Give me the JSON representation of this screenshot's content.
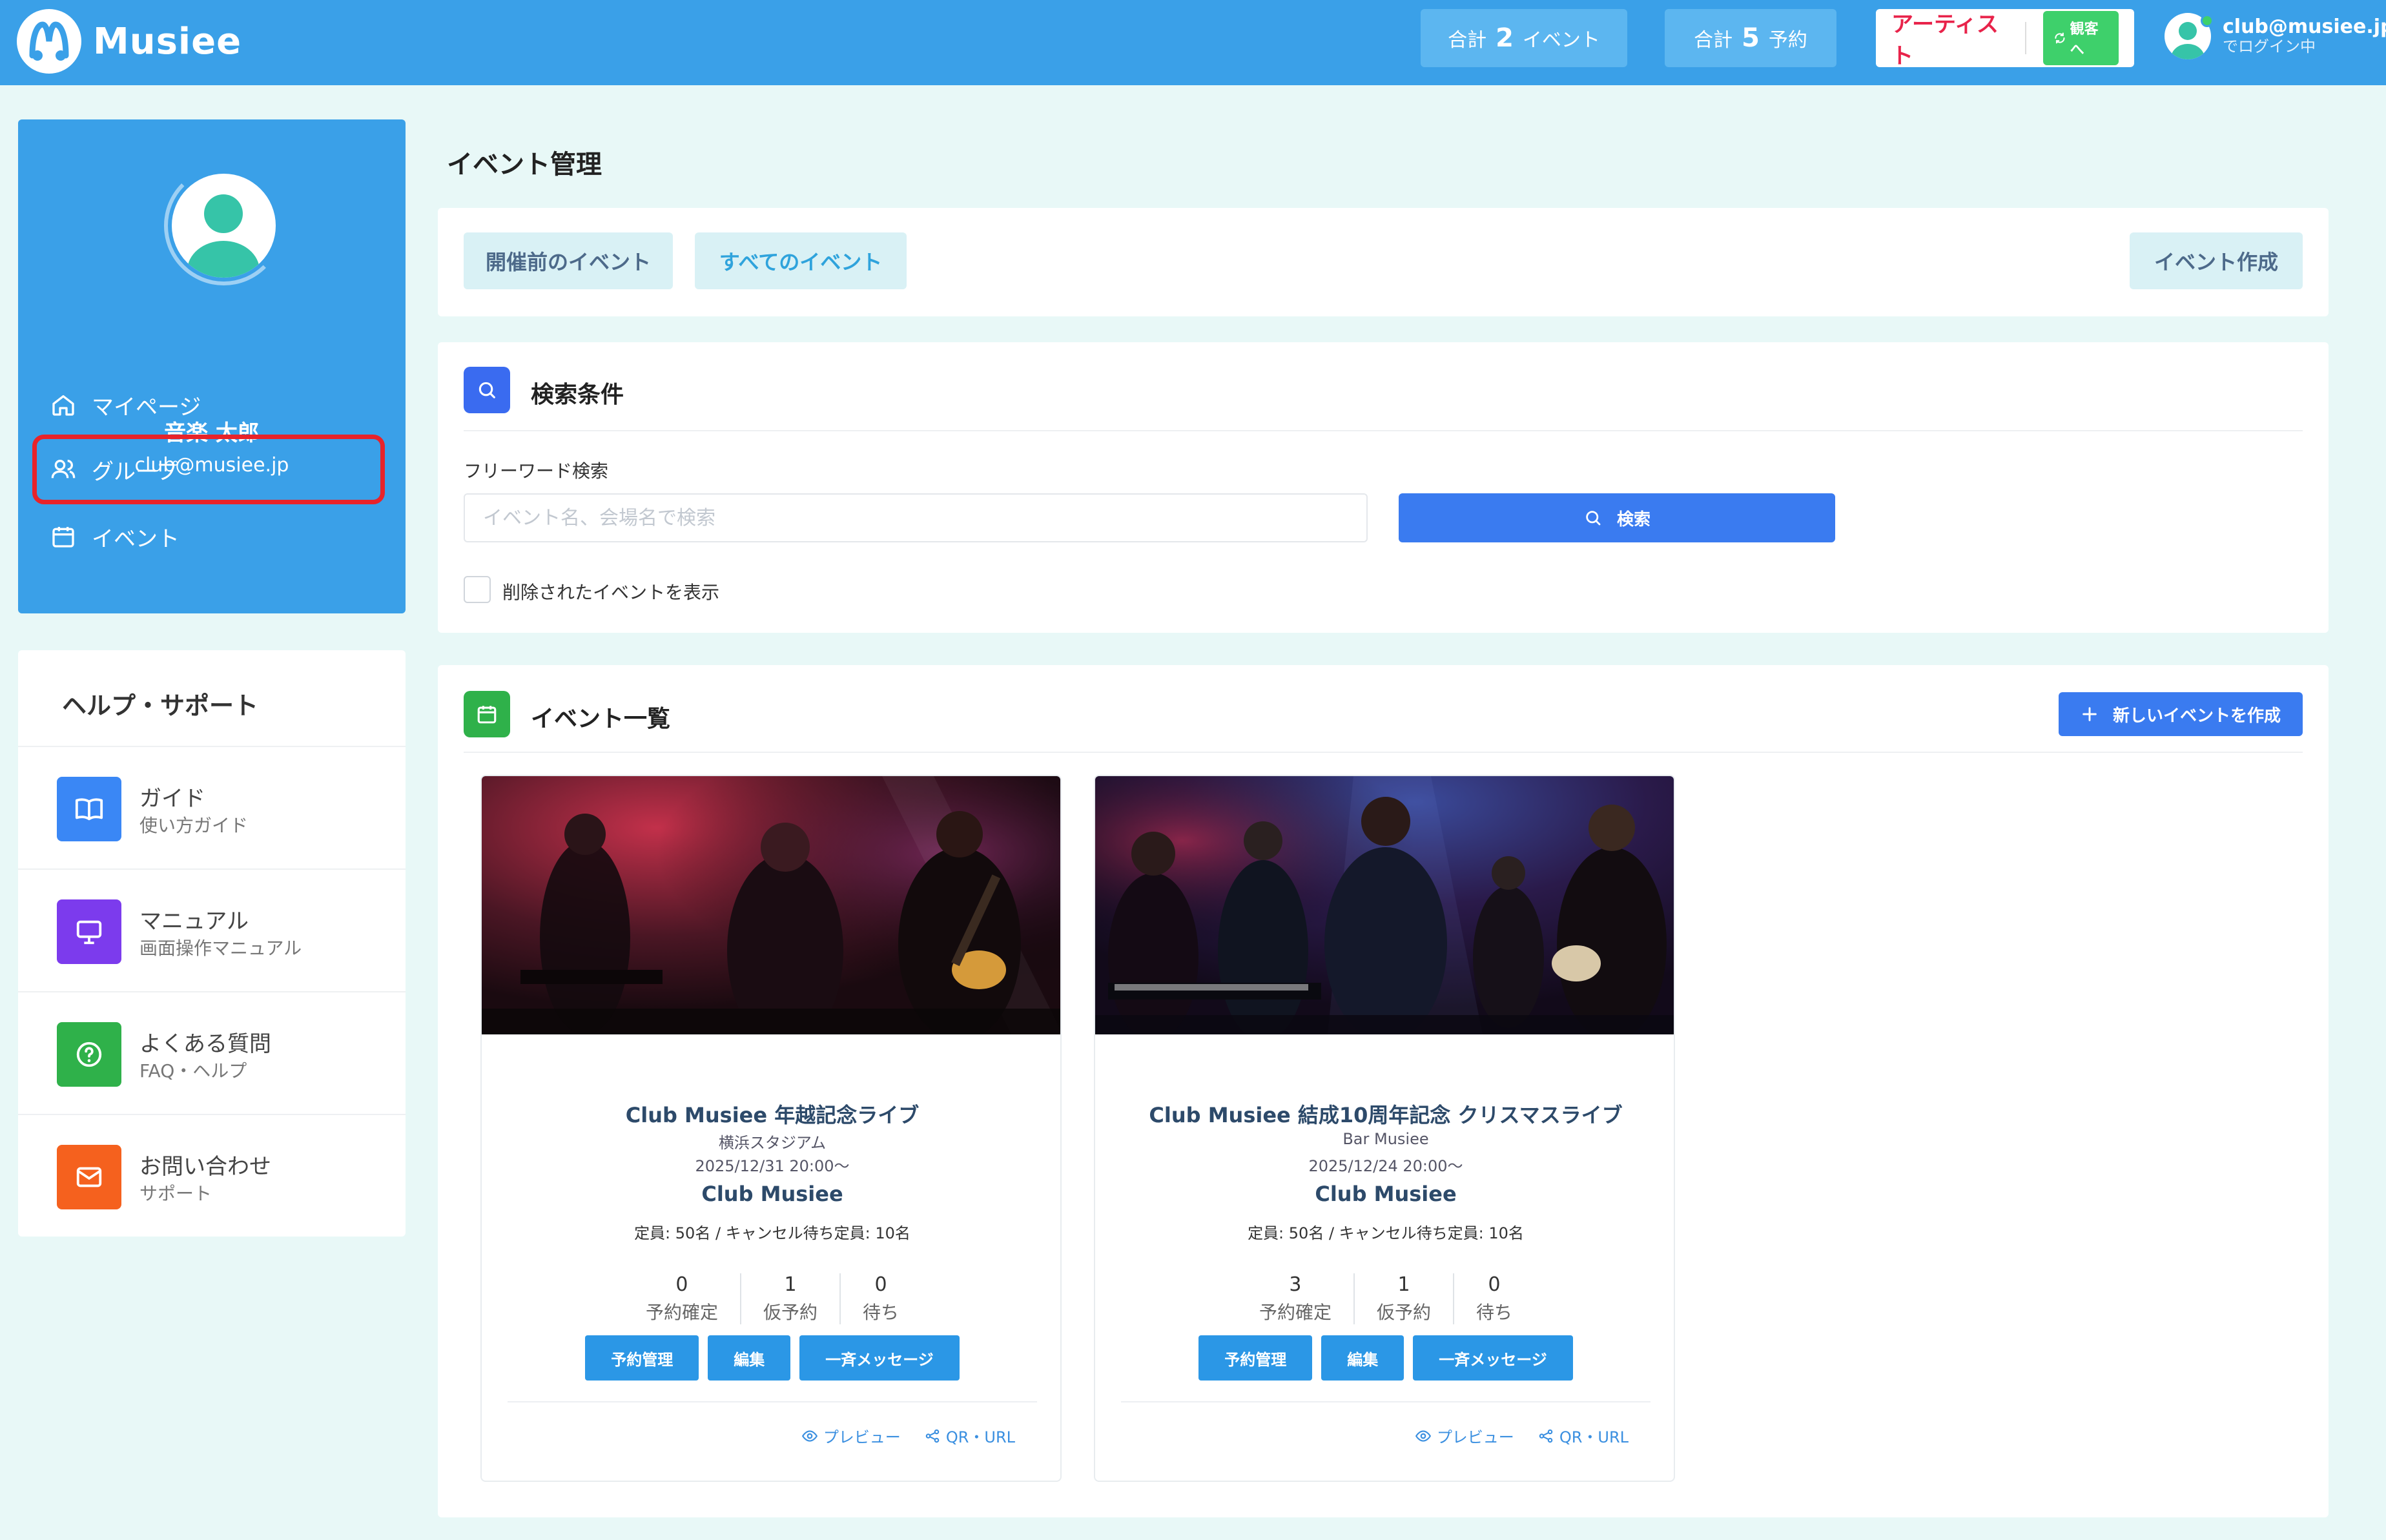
{
  "header": {
    "brand": "Musiee",
    "stats": [
      {
        "prefix": "合計",
        "value": "2",
        "unit": "イベント"
      },
      {
        "prefix": "合計",
        "value": "5",
        "unit": "予約"
      }
    ],
    "role_label": "アーティスト",
    "role_switch_label": "観客へ",
    "user_email": "club@musiee.jp",
    "user_status": "でログイン中"
  },
  "sidebar": {
    "profile_name": "音楽 太郎",
    "profile_email": "club@musiee.jp",
    "nav": [
      {
        "label": "マイページ",
        "icon": "home-icon"
      },
      {
        "label": "グループ",
        "icon": "users-icon",
        "highlighted": true
      },
      {
        "label": "イベント",
        "icon": "calendar-icon"
      }
    ],
    "help_title": "ヘルプ・サポート",
    "help_items": [
      {
        "label": "ガイド",
        "sub": "使い方ガイド",
        "icon": "book-icon",
        "color": "#3a87f5"
      },
      {
        "label": "マニュアル",
        "sub": "画面操作マニュアル",
        "icon": "monitor-icon",
        "color": "#7c3bed"
      },
      {
        "label": "よくある質問",
        "sub": "FAQ・ヘルプ",
        "icon": "question-icon",
        "color": "#2fb14a"
      },
      {
        "label": "お問い合わせ",
        "sub": "サポート",
        "icon": "mail-icon",
        "color": "#f5611e"
      }
    ]
  },
  "main": {
    "page_title": "イベント管理",
    "tabs": [
      {
        "label": "開催前のイベント"
      },
      {
        "label": "すべてのイベント",
        "active": true
      }
    ],
    "create_label": "イベント作成",
    "search": {
      "title": "検索条件",
      "field_label": "フリーワード検索",
      "placeholder": "イベント名、会場名で検索",
      "value": "",
      "button_label": "検索",
      "checkbox_label": "削除されたイベントを表示",
      "checked": false
    },
    "list": {
      "title": "イベント一覧",
      "new_button_label": "新しいイベントを作成",
      "events": [
        {
          "title": "Club Musiee 年越記念ライブ",
          "venue": "横浜スタジアム",
          "date": "2025/12/31 20:00〜",
          "organizer": "Club Musiee",
          "capacity": "定員: 50名 / キャンセル待ち定員: 10名",
          "stats": [
            {
              "value": "0",
              "label": "予約確定"
            },
            {
              "value": "1",
              "label": "仮予約"
            },
            {
              "value": "0",
              "label": "待ち"
            }
          ],
          "actions": [
            "予約管理",
            "編集",
            "一斉メッセージ"
          ],
          "links": [
            "プレビュー",
            "QR・URL"
          ]
        },
        {
          "title": "Club Musiee 結成10周年記念 クリスマスライブ",
          "venue": "Bar Musiee",
          "date": "2025/12/24 20:00〜",
          "organizer": "Club Musiee",
          "capacity": "定員: 50名 / キャンセル待ち定員: 10名",
          "stats": [
            {
              "value": "3",
              "label": "予約確定"
            },
            {
              "value": "1",
              "label": "仮予約"
            },
            {
              "value": "0",
              "label": "待ち"
            }
          ],
          "actions": [
            "予約管理",
            "編集",
            "一斉メッセージ"
          ],
          "links": [
            "プレビュー",
            "QR・URL"
          ]
        }
      ]
    }
  },
  "colors": {
    "header_bg": "#3aa0e8",
    "page_bg": "#e8f8f7",
    "primary_button": "#3a7bf0",
    "card_button": "#2b97e6",
    "highlight_border": "#e8232a"
  }
}
